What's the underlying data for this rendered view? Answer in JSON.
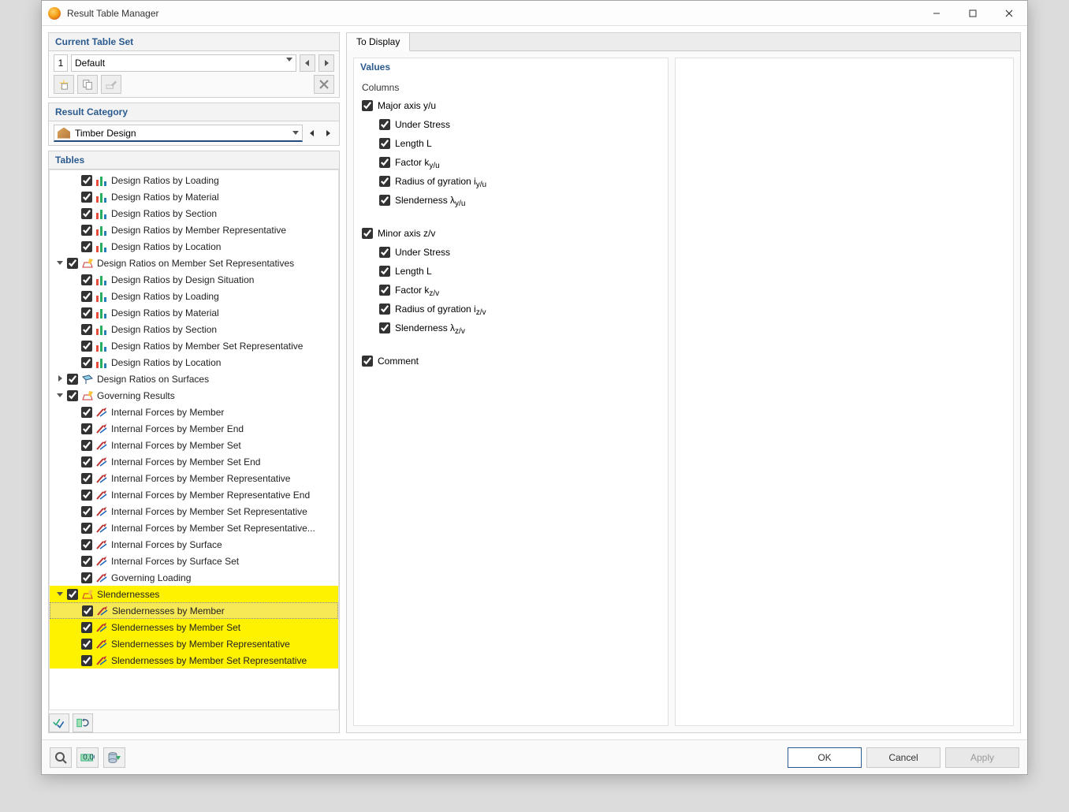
{
  "window": {
    "title": "Result Table Manager"
  },
  "tableset": {
    "heading": "Current Table Set",
    "index": "1",
    "name": "Default",
    "btn_new": "new-tableset",
    "btn_copy": "copy-tableset",
    "btn_rename": "rename-tableset",
    "btn_delete": "delete-tableset"
  },
  "category": {
    "heading": "Result Category",
    "value": "Timber Design"
  },
  "tables": {
    "heading": "Tables",
    "items": [
      {
        "depth": 2,
        "icon": "ratio",
        "label": "Design Ratios by Loading"
      },
      {
        "depth": 2,
        "icon": "ratio",
        "label": "Design Ratios by Material"
      },
      {
        "depth": 2,
        "icon": "ratio",
        "label": "Design Ratios by Section"
      },
      {
        "depth": 2,
        "icon": "ratio",
        "label": "Design Ratios by Member Representative"
      },
      {
        "depth": 2,
        "icon": "ratio",
        "label": "Design Ratios by Location"
      },
      {
        "depth": 1,
        "exp": "open",
        "icon": "pencil",
        "label": "Design Ratios on Member Set Representatives"
      },
      {
        "depth": 2,
        "icon": "ratio",
        "label": "Design Ratios by Design Situation"
      },
      {
        "depth": 2,
        "icon": "ratio",
        "label": "Design Ratios by Loading"
      },
      {
        "depth": 2,
        "icon": "ratio",
        "label": "Design Ratios by Material"
      },
      {
        "depth": 2,
        "icon": "ratio",
        "label": "Design Ratios by Section"
      },
      {
        "depth": 2,
        "icon": "ratio",
        "label": "Design Ratios by Member Set Representative"
      },
      {
        "depth": 2,
        "icon": "ratio",
        "label": "Design Ratios by Location"
      },
      {
        "depth": 1,
        "exp": "closed",
        "icon": "surface",
        "label": "Design Ratios on Surfaces"
      },
      {
        "depth": 1,
        "exp": "open",
        "icon": "pencil",
        "label": "Governing Results"
      },
      {
        "depth": 2,
        "icon": "vector",
        "label": "Internal Forces by Member"
      },
      {
        "depth": 2,
        "icon": "vector",
        "label": "Internal Forces by Member End"
      },
      {
        "depth": 2,
        "icon": "vector",
        "label": "Internal Forces by Member Set"
      },
      {
        "depth": 2,
        "icon": "vector",
        "label": "Internal Forces by Member Set End"
      },
      {
        "depth": 2,
        "icon": "vector",
        "label": "Internal Forces by Member Representative"
      },
      {
        "depth": 2,
        "icon": "vector",
        "label": "Internal Forces by Member Representative End"
      },
      {
        "depth": 2,
        "icon": "vector",
        "label": "Internal Forces by Member Set Representative"
      },
      {
        "depth": 2,
        "icon": "vector",
        "label": "Internal Forces by Member Set Representative..."
      },
      {
        "depth": 2,
        "icon": "vector",
        "label": "Internal Forces by Surface"
      },
      {
        "depth": 2,
        "icon": "vector",
        "label": "Internal Forces by Surface Set"
      },
      {
        "depth": 2,
        "icon": "vector",
        "label": "Governing Loading"
      },
      {
        "depth": 1,
        "exp": "open",
        "icon": "pencil",
        "label": "Slendernesses",
        "hl": true
      },
      {
        "depth": 2,
        "icon": "vector",
        "label": "Slendernesses by Member",
        "hl": true,
        "sel": true
      },
      {
        "depth": 2,
        "icon": "vector",
        "label": "Slendernesses by Member Set",
        "hl": true
      },
      {
        "depth": 2,
        "icon": "vector",
        "label": "Slendernesses by Member Representative",
        "hl": true
      },
      {
        "depth": 2,
        "icon": "vector",
        "label": "Slendernesses by Member Set Representative",
        "hl": true
      }
    ],
    "footer": {
      "btn_check_all": "check-all",
      "btn_save_set": "save-table-set"
    }
  },
  "right": {
    "tab": "To Display",
    "values_heading": "Values",
    "columns_label": "Columns",
    "rows": [
      {
        "type": "check",
        "label": "Major axis y/u"
      },
      {
        "type": "sub",
        "label": "Under Stress"
      },
      {
        "type": "sub",
        "label": "Length L"
      },
      {
        "type": "sub",
        "label_html": "Factor k<sub>y/u</sub>"
      },
      {
        "type": "sub",
        "label_html": "Radius of gyration i<sub>y/u</sub>"
      },
      {
        "type": "sub",
        "label_html": "Slenderness λ<sub>y/u</sub>"
      },
      {
        "type": "gap"
      },
      {
        "type": "check",
        "label": "Minor axis z/v"
      },
      {
        "type": "sub",
        "label": "Under Stress"
      },
      {
        "type": "sub",
        "label": "Length L"
      },
      {
        "type": "sub",
        "label_html": "Factor k<sub>z/v</sub>"
      },
      {
        "type": "sub",
        "label_html": "Radius of gyration i<sub>z/v</sub>"
      },
      {
        "type": "sub",
        "label_html": "Slenderness λ<sub>z/v</sub>"
      },
      {
        "type": "gap"
      },
      {
        "type": "check",
        "label": "Comment"
      }
    ]
  },
  "footer": {
    "help": "help",
    "units": "units",
    "export": "export",
    "ok": "OK",
    "cancel": "Cancel",
    "apply": "Apply"
  }
}
